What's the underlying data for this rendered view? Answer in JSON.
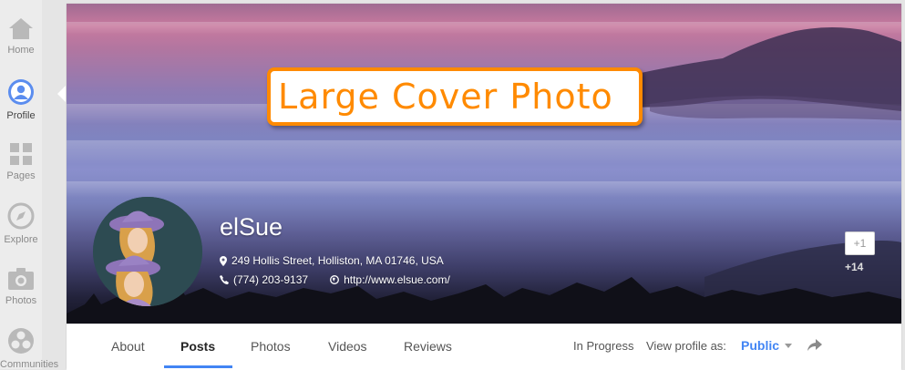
{
  "nav": {
    "items": [
      {
        "label": "Home",
        "icon": "home-icon"
      },
      {
        "label": "Profile",
        "icon": "profile-icon"
      },
      {
        "label": "Pages",
        "icon": "pages-icon"
      },
      {
        "label": "Explore",
        "icon": "explore-icon"
      },
      {
        "label": "Photos",
        "icon": "photos-icon"
      },
      {
        "label": "Communities",
        "icon": "communities-icon"
      }
    ],
    "active": "Profile"
  },
  "cover": {
    "callout_text": "Large Cover Photo",
    "callout_color": "#ff8a00"
  },
  "profile": {
    "name": "elSue",
    "address": "249 Hollis Street, Holliston, MA 01746, USA",
    "phone": "(774) 203-9137",
    "website": "http://www.elsue.com/"
  },
  "plus_one": {
    "label": "+1",
    "count": "+14"
  },
  "tabs": [
    {
      "label": "About"
    },
    {
      "label": "Posts"
    },
    {
      "label": "Photos"
    },
    {
      "label": "Videos"
    },
    {
      "label": "Reviews"
    }
  ],
  "active_tab": "Posts",
  "status_text": "In Progress",
  "view_profile": {
    "label": "View profile as:",
    "value": "Public"
  },
  "colors": {
    "accent": "#4285f4"
  }
}
